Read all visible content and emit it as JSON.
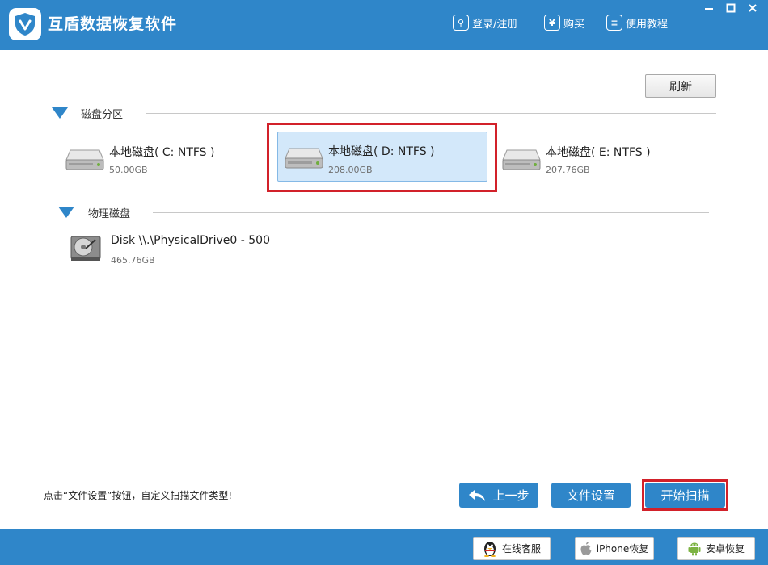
{
  "window": {
    "title": "互盾数据恢复软件",
    "links": {
      "login": "登录/注册",
      "buy": "购买",
      "guide": "使用教程"
    }
  },
  "toolbar": {
    "refresh_label": "刷新"
  },
  "partitions": {
    "title": "磁盘分区",
    "drives": [
      {
        "name": "本地磁盘( C: NTFS )",
        "size": "50.00GB",
        "selected": false
      },
      {
        "name": "本地磁盘( D: NTFS )",
        "size": "208.00GB",
        "selected": true
      },
      {
        "name": "本地磁盘( E: NTFS )",
        "size": "207.76GB",
        "selected": false
      }
    ]
  },
  "physical": {
    "title": "物理磁盘",
    "disks": [
      {
        "name": "Disk \\\\.\\PhysicalDrive0 - 500",
        "size": "465.76GB"
      }
    ]
  },
  "footer": {
    "hint": "点击“文件设置”按钮，自定义扫描文件类型!",
    "prev_label": "上一步",
    "settings_label": "文件设置",
    "scan_label": "开始扫描"
  },
  "bottom_bar": {
    "support_label": "在线客服",
    "iphone_label": "iPhone恢复",
    "android_label": "安卓恢复"
  },
  "colors": {
    "brand_blue": "#2f86c9",
    "selection_bg": "#d3e8fa",
    "highlight_red": "#d2212a"
  }
}
